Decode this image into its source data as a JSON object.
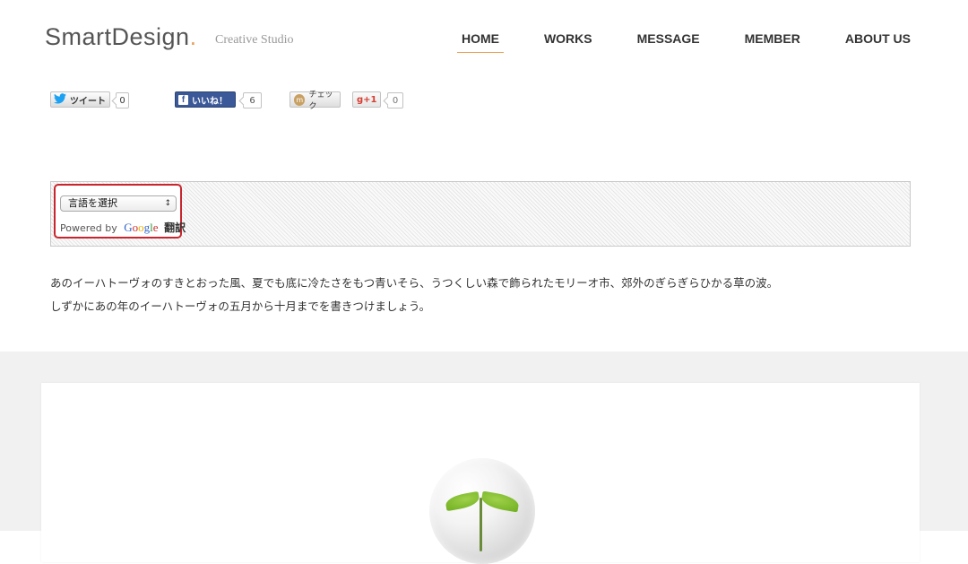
{
  "header": {
    "logo_text": "SmartDesign",
    "logo_dot": ".",
    "tagline": "Creative Studio",
    "nav": [
      {
        "label": "HOME",
        "active": true
      },
      {
        "label": "WORKS",
        "active": false
      },
      {
        "label": "MESSAGE",
        "active": false
      },
      {
        "label": "MEMBER",
        "active": false
      },
      {
        "label": "ABOUT US",
        "active": false
      }
    ]
  },
  "social": {
    "tweet_label": "ツイート",
    "tweet_count": "0",
    "like_icon": "f",
    "like_label": "いいね！",
    "like_count": "6",
    "mixi_icon": "m",
    "check_label": "チェック",
    "gplus_label": "g+1",
    "gplus_count": "0"
  },
  "translate": {
    "select_value": "言語を選択",
    "powered_by": "Powered by",
    "google": "Google",
    "translate_word": "翻訳"
  },
  "content": {
    "line1": "あのイーハトーヴォのすきとおった風、夏でも底に冷たさをもつ青いそら、うつくしい森で飾られたモリーオ市、郊外のぎらぎらひかる草の波。",
    "line2": "しずかにあの年のイーハトーヴォの五月から十月までを書きつけましょう。"
  },
  "colors": {
    "accent": "#e8a05a",
    "facebook": "#3b5998",
    "widget_border": "#c8262f",
    "section_bg": "#f1f1f1"
  }
}
